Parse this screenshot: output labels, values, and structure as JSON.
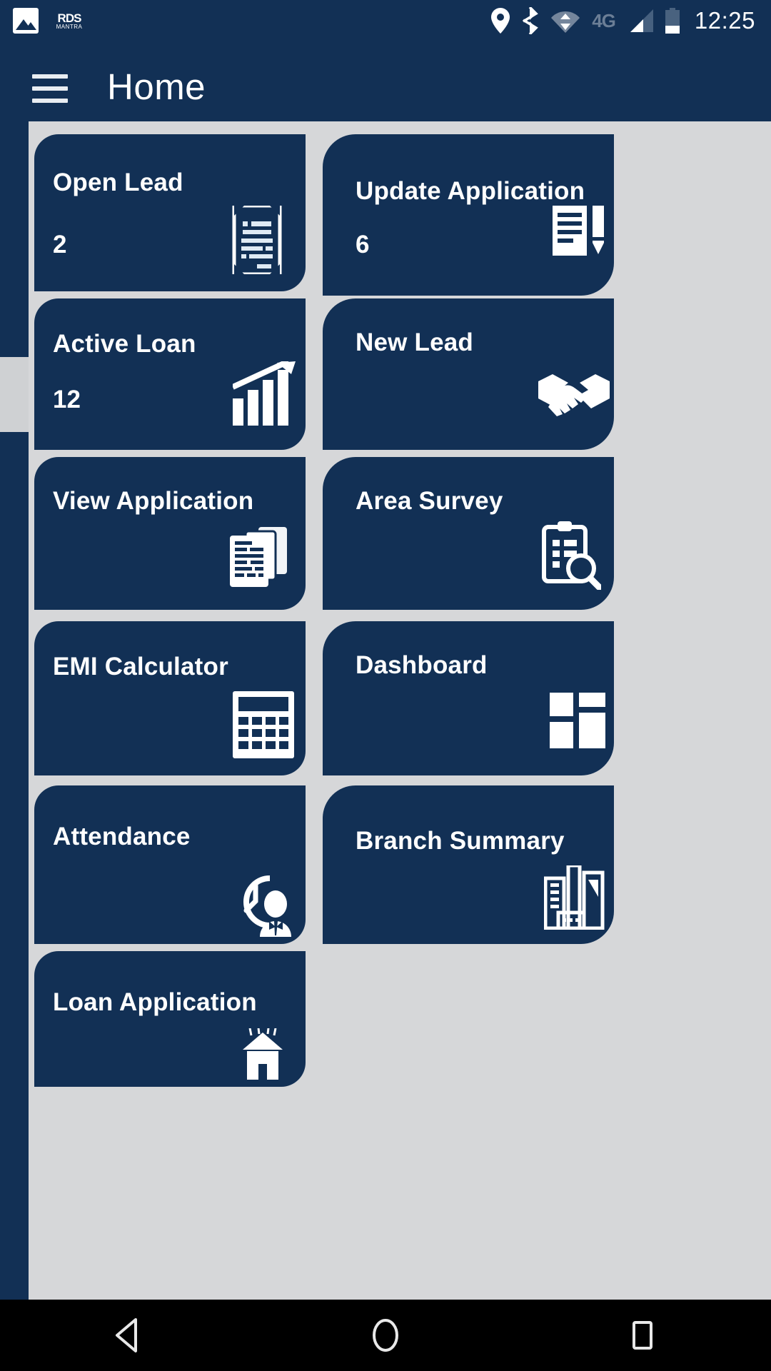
{
  "status_bar": {
    "time": "12:25",
    "network_label": "4G",
    "icons": [
      "photo-icon",
      "rdc-mantra-logo",
      "location-pin-icon",
      "bluetooth-icon",
      "wifi-icon",
      "signal-bars-icon",
      "battery-icon"
    ],
    "logo": {
      "line1": "RDS",
      "line2": "MANTRA"
    }
  },
  "app_bar": {
    "title": "Home",
    "menu_icon": "hamburger-menu-icon"
  },
  "theme": {
    "card_bg": "#123055",
    "page_bg": "#d6d7d9",
    "text": "#ffffff",
    "nav_bg": "#000000"
  },
  "tiles": [
    {
      "title": "Open Lead",
      "count": "2",
      "icon": "document-lines-icon"
    },
    {
      "title": "Update Application",
      "count": "6",
      "icon": "document-pencil-icon"
    },
    {
      "title": "Active Loan",
      "count": "12",
      "icon": "bar-chart-arrow-icon"
    },
    {
      "title": "New Lead",
      "count": "",
      "icon": "handshake-icon"
    },
    {
      "title": "View Application",
      "count": "",
      "icon": "stacked-documents-icon"
    },
    {
      "title": "Area Survey",
      "count": "",
      "icon": "clipboard-search-icon"
    },
    {
      "title": "EMI Calculator",
      "count": "",
      "icon": "calculator-icon"
    },
    {
      "title": "Dashboard",
      "count": "",
      "icon": "dashboard-grid-icon"
    },
    {
      "title": "Attendance",
      "count": "",
      "icon": "clock-person-icon"
    },
    {
      "title": "Branch Summary",
      "count": "",
      "icon": "buildings-icon"
    },
    {
      "title": "Loan Application",
      "count": "",
      "icon": "house-icon"
    }
  ],
  "nav_bar": {
    "back_label": "back-button",
    "home_label": "home-button",
    "recents_label": "recents-button"
  }
}
